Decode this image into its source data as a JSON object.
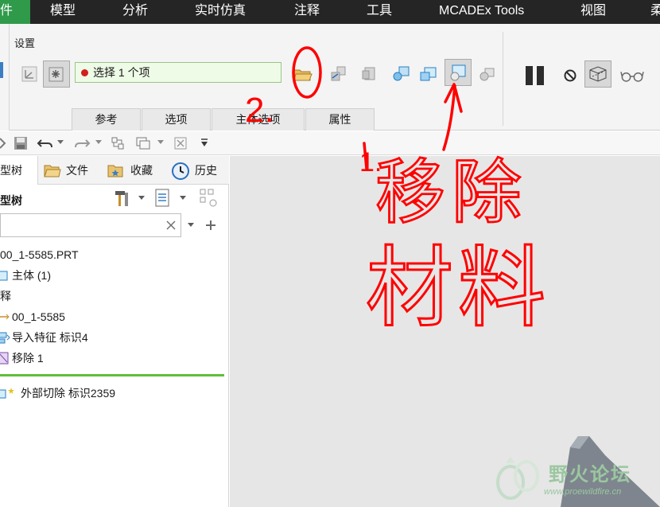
{
  "menubar": {
    "items": [
      "件",
      "模型",
      "分析",
      "实时仿真",
      "注释",
      "工具",
      "MCADEx Tools",
      "视图",
      "柔"
    ]
  },
  "ribbon": {
    "group_title": "设置",
    "select_box_text": "选择 1 个项",
    "tabs": [
      "参考",
      "选项",
      "主体选项",
      "属性"
    ]
  },
  "left_panel": {
    "tabs": [
      "模型树",
      "文件",
      "收藏",
      "历史"
    ],
    "tree_label": "型树",
    "tree_items": [
      "00_1-5585.PRT",
      "主体 (1)",
      "注释",
      "00_1-5585",
      "导入特征 标识4",
      "移除 1",
      "外部切除 标识2359"
    ]
  },
  "annotations": {
    "step_label": "2.",
    "step_one": "1.",
    "handwritten_line1": "移除",
    "handwritten_line2": "材料"
  },
  "watermark": {
    "text": "野火论坛",
    "url": "www.proewildfire.cn"
  },
  "colors": {
    "menubar_bg": "#252526",
    "active_menu": "#2f9a4a",
    "annotation_red": "#ff0000",
    "select_box_bg": "#eefbe6",
    "separator_green": "#5fbf3a"
  }
}
